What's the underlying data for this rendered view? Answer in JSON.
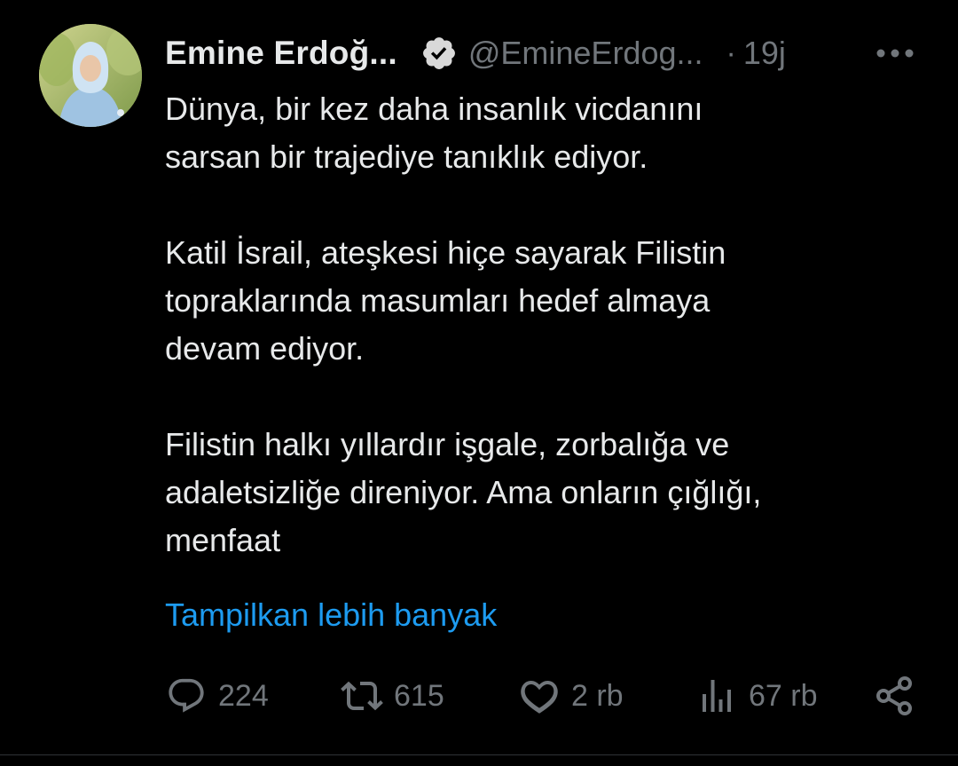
{
  "author": {
    "display_name": "Emine Erdoğ...",
    "handle": "@EmineErdog...",
    "separator": "·",
    "time": "19j",
    "verified_icon": "verified-badge-icon",
    "verified_color": "#d9d9d9"
  },
  "tweet": {
    "paragraphs": [
      [
        "Dünya, bir kez daha insanlık vicdanını",
        "sarsan bir trajediye tanıklık ediyor."
      ],
      [
        "Katil İsrail, ateşkesi hiçe sayarak Filistin",
        "topraklarında masumları hedef almaya",
        "devam ediyor."
      ],
      [
        "Filistin halkı yıllardır işgale, zorbalığa ve",
        "adaletsizliğe direniyor. Ama onların çığlığı,",
        "menfaat"
      ]
    ],
    "show_more": "Tampilkan lebih banyak"
  },
  "actions": {
    "reply": {
      "icon": "reply-icon",
      "count": "224"
    },
    "retweet": {
      "icon": "retweet-icon",
      "count": "615"
    },
    "like": {
      "icon": "heart-icon",
      "count": "2 rb"
    },
    "views": {
      "icon": "views-chart-icon",
      "count": "67 rb"
    },
    "share": {
      "icon": "share-icon"
    }
  },
  "colors": {
    "background": "#000000",
    "text": "#e7e9ea",
    "muted": "#71767b",
    "link": "#1d9bf0"
  }
}
